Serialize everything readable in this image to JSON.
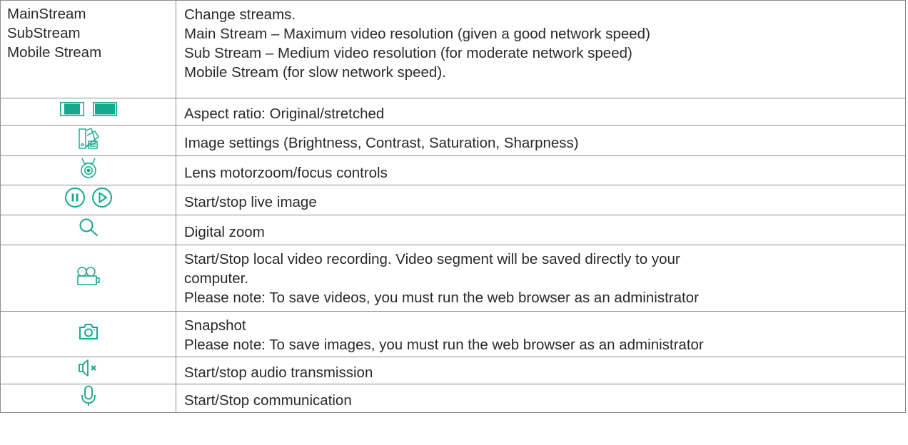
{
  "accent_color": "#14a88c",
  "rows": [
    {
      "streams": [
        "MainStream",
        "SubStream",
        "Mobile Stream"
      ],
      "description": [
        "Change streams.",
        "Main Stream – Maximum video resolution (given a good network speed)",
        "Sub Stream – Medium video resolution (for moderate network speed)",
        "Mobile Stream (for slow network speed)."
      ]
    },
    {
      "icons": [
        "aspect-original-icon",
        "aspect-stretched-icon"
      ],
      "description": [
        "Aspect ratio: Original/stretched"
      ]
    },
    {
      "icons": [
        "image-settings-icon"
      ],
      "description": [
        "Image settings (Brightness, Contrast, Saturation, Sharpness)"
      ]
    },
    {
      "icons": [
        "lens-icon"
      ],
      "description": [
        "Lens motorzoom/focus controls"
      ]
    },
    {
      "icons": [
        "pause-icon",
        "play-icon"
      ],
      "description": [
        "Start/stop live image"
      ]
    },
    {
      "icons": [
        "magnifier-icon"
      ],
      "description": [
        "Digital zoom"
      ]
    },
    {
      "icons": [
        "video-camera-icon"
      ],
      "description": [
        "Start/Stop local video recording. Video segment will be saved directly to your",
        "computer.",
        "Please note: To save videos, you must run the web browser as an administrator"
      ]
    },
    {
      "icons": [
        "camera-icon"
      ],
      "description": [
        "Snapshot",
        "Please note: To save images, you must run the web browser as an administrator"
      ]
    },
    {
      "icons": [
        "speaker-muted-icon"
      ],
      "description": [
        "Start/stop audio transmission"
      ]
    },
    {
      "icons": [
        "microphone-icon"
      ],
      "description": [
        "Start/Stop communication"
      ]
    }
  ]
}
